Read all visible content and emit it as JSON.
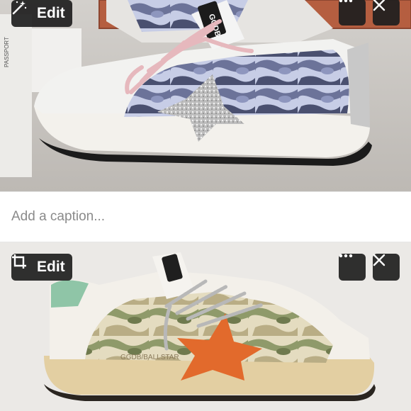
{
  "photos": [
    {
      "edit_label": "Edit",
      "edit_icon": "magic-wand-icon",
      "more_icon": "ellipsis-icon",
      "close_icon": "close-icon"
    },
    {
      "edit_label": "Edit",
      "edit_icon": "crop-icon",
      "more_icon": "ellipsis-icon",
      "close_icon": "close-icon"
    }
  ],
  "caption": {
    "placeholder": "Add a caption..."
  },
  "product": {
    "box_label": "PASSPORT",
    "tongue_label": "GGDB",
    "side_print": "GGDB/BALLSTAR"
  },
  "colors": {
    "button_bg": "#1e1e1e",
    "caption_placeholder": "#8a8a8a",
    "star_orange": "#e26a2c",
    "star_silver": "#c9c9c9"
  }
}
